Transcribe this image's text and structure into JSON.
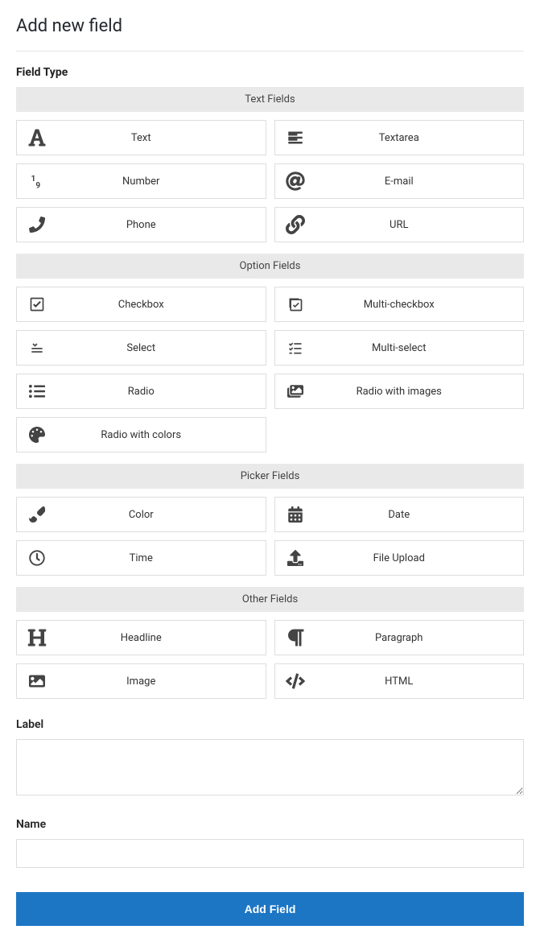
{
  "page_title": "Add new field",
  "field_type_label": "Field Type",
  "groups": [
    {
      "header": "Text Fields",
      "items": [
        {
          "label": "Text",
          "icon": "font",
          "name": "field-type-text"
        },
        {
          "label": "Textarea",
          "icon": "align-left",
          "name": "field-type-textarea"
        },
        {
          "label": "Number",
          "icon": "numeric",
          "name": "field-type-number"
        },
        {
          "label": "E-mail",
          "icon": "at",
          "name": "field-type-email"
        },
        {
          "label": "Phone",
          "icon": "phone",
          "name": "field-type-phone"
        },
        {
          "label": "URL",
          "icon": "link",
          "name": "field-type-url"
        }
      ]
    },
    {
      "header": "Option Fields",
      "items": [
        {
          "label": "Checkbox",
          "icon": "checkbox",
          "name": "field-type-checkbox"
        },
        {
          "label": "Multi-checkbox",
          "icon": "multi-checkbox",
          "name": "field-type-multi-checkbox"
        },
        {
          "label": "Select",
          "icon": "select",
          "name": "field-type-select"
        },
        {
          "label": "Multi-select",
          "icon": "multi-select",
          "name": "field-type-multi-select"
        },
        {
          "label": "Radio",
          "icon": "list-ul",
          "name": "field-type-radio"
        },
        {
          "label": "Radio with images",
          "icon": "images",
          "name": "field-type-radio-images"
        },
        {
          "label": "Radio with colors",
          "icon": "palette",
          "name": "field-type-radio-colors"
        }
      ]
    },
    {
      "header": "Picker Fields",
      "items": [
        {
          "label": "Color",
          "icon": "brush",
          "name": "field-type-color"
        },
        {
          "label": "Date",
          "icon": "calendar",
          "name": "field-type-date"
        },
        {
          "label": "Time",
          "icon": "clock",
          "name": "field-type-time"
        },
        {
          "label": "File Upload",
          "icon": "upload",
          "name": "field-type-file-upload"
        }
      ]
    },
    {
      "header": "Other Fields",
      "items": [
        {
          "label": "Headline",
          "icon": "heading",
          "name": "field-type-headline"
        },
        {
          "label": "Paragraph",
          "icon": "paragraph",
          "name": "field-type-paragraph"
        },
        {
          "label": "Image",
          "icon": "image",
          "name": "field-type-image"
        },
        {
          "label": "HTML",
          "icon": "code",
          "name": "field-type-html"
        }
      ]
    }
  ],
  "label_field_label": "Label",
  "label_field_value": "",
  "name_field_label": "Name",
  "name_field_value": "",
  "submit_label": "Add Field"
}
